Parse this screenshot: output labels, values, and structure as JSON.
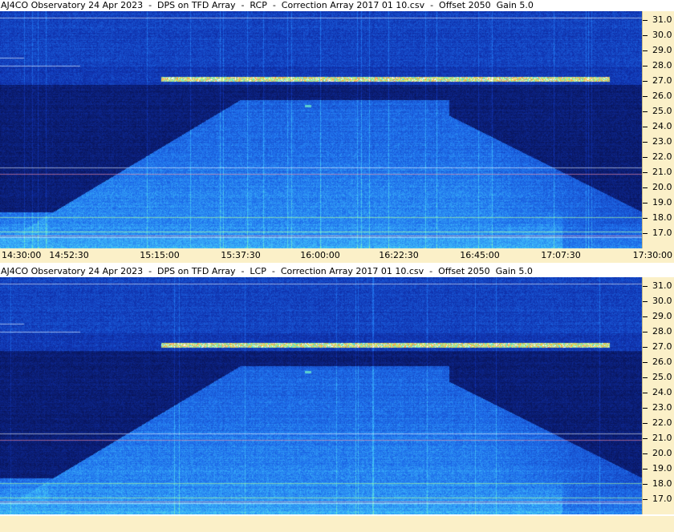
{
  "panels": [
    {
      "title": "AJ4CO Observatory 24 Apr 2023  -  DPS on TFD Array  -  RCP  -  Correction Array 2017 01 10.csv  -  Offset 2050  Gain 5.0",
      "polarization": "RCP",
      "freq_labels": [
        "31.0",
        "30.0",
        "29.0",
        "28.0",
        "27.0",
        "26.0",
        "25.0",
        "24.0",
        "23.0",
        "22.0",
        "21.0",
        "20.0",
        "19.0",
        "18.0",
        "17.0"
      ],
      "time_labels": [
        "14:30:00",
        "14:52:30",
        "15:15:00",
        "15:37:30",
        "16:00:00",
        "16:22:30",
        "16:45:00",
        "17:07:30",
        "17:30:00"
      ]
    },
    {
      "title": "AJ4CO Observatory 24 Apr 2023  -  DPS on TFD Array  -  LCP  -  Correction Array 2017 01 10.csv  -  Offset 2050  Gain 5.0",
      "polarization": "LCP",
      "freq_labels": [
        "31.0",
        "30.0",
        "29.0",
        "28.0",
        "27.0",
        "26.0",
        "25.0",
        "24.0",
        "23.0",
        "22.0",
        "21.0",
        "20.0",
        "19.0",
        "18.0",
        "17.0"
      ]
    }
  ]
}
